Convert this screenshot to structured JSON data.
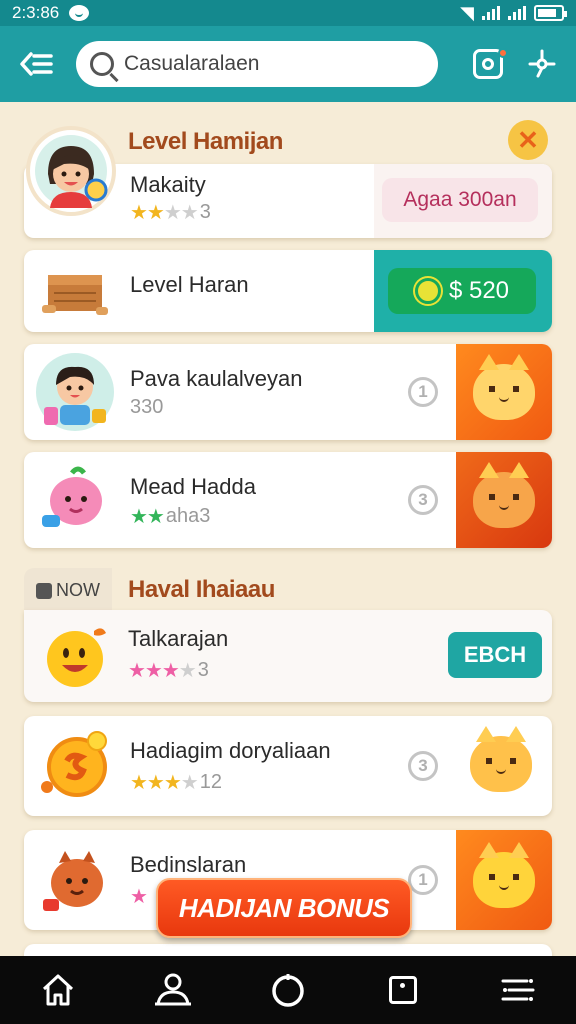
{
  "status_bar": {
    "time": "2:3:86"
  },
  "search": {
    "value": "Casualaralaen"
  },
  "section1_title": "Level Hamijan",
  "section2_title": "Haval Ihaiaau",
  "new_tag": "NOW",
  "cards": [
    {
      "title": "Makaity",
      "rating_text": "3",
      "action_label": "Agaa 300an"
    },
    {
      "title": "Level Haran",
      "price_label": "$ 520"
    },
    {
      "title": "Pava kaulalveyan",
      "sub": "330",
      "badge": "1"
    },
    {
      "title": "Mead Hadda",
      "sub": "aha3",
      "badge": "3"
    },
    {
      "title": "Talkarajan",
      "rating_text": "3",
      "action_label": "EBCH"
    },
    {
      "title": "Hadiagim doryaliaan",
      "rating_text": "12",
      "badge": "3"
    },
    {
      "title": "Bedinslaran",
      "badge": "1"
    }
  ],
  "bonus_label": "HADIJAN BONUS",
  "colors": {
    "teal": "#1f9ea3",
    "orange": "#f05a12",
    "green": "#1fab5b",
    "cream": "#f6ecd7"
  },
  "icons": {
    "back": "back-menu-icon",
    "search": "search-icon",
    "camera": "camera-icon",
    "share": "share-icon",
    "nav": [
      "home-icon",
      "profile-icon",
      "circle-icon",
      "photo-icon",
      "menu-icon"
    ]
  }
}
